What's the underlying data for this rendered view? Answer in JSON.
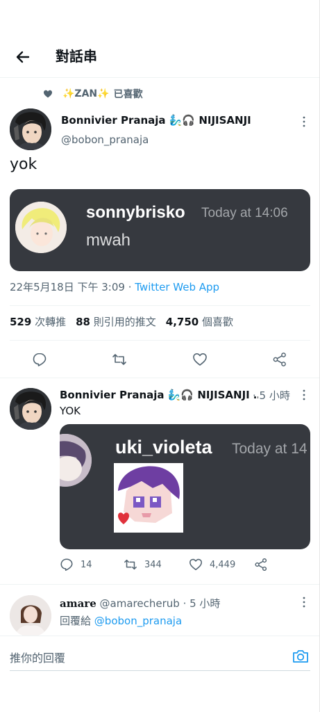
{
  "header": {
    "title": "對話串"
  },
  "liked_by": {
    "name": "✨ZAN✨",
    "suffix": "已喜歡"
  },
  "main_tweet": {
    "display_name": "Bonnivier Pranaja 🧞‍♂️🎧 NIJISANJI",
    "handle": "@bobon_pranaja",
    "text": "yok",
    "discord": {
      "username": "sonnybrisko",
      "time": "Today at 14:06",
      "message": "mwah"
    },
    "date": "22年5月18日 下午 3:09 · ",
    "source": "Twitter Web App",
    "stats": {
      "retweets": "529",
      "retweets_label": "次轉推",
      "quotes": "88",
      "quotes_label": "則引用的推文",
      "likes": "4,750",
      "likes_label": "個喜歡"
    }
  },
  "reply_tweet": {
    "display_name": "Bonnivier Pranaja 🧞‍♂️🎧 NIJISANJI …",
    "time": "· 5 小時",
    "text": "YOK",
    "discord": {
      "username": "uki_violeta",
      "time": "Today at 14"
    },
    "replies": "14",
    "retweets": "344",
    "likes": "4,449"
  },
  "third_tweet": {
    "display_name": "amare",
    "handle": "@amarecherub",
    "time": "· 5 小時",
    "reply_prefix": "回覆給",
    "reply_to": "@bobon_pranaja"
  },
  "reply_bar": {
    "placeholder": "推你的回覆"
  },
  "colors": {
    "accent": "#1d9bf0",
    "discord_bg": "#36393f",
    "secondary_text": "#536471"
  }
}
